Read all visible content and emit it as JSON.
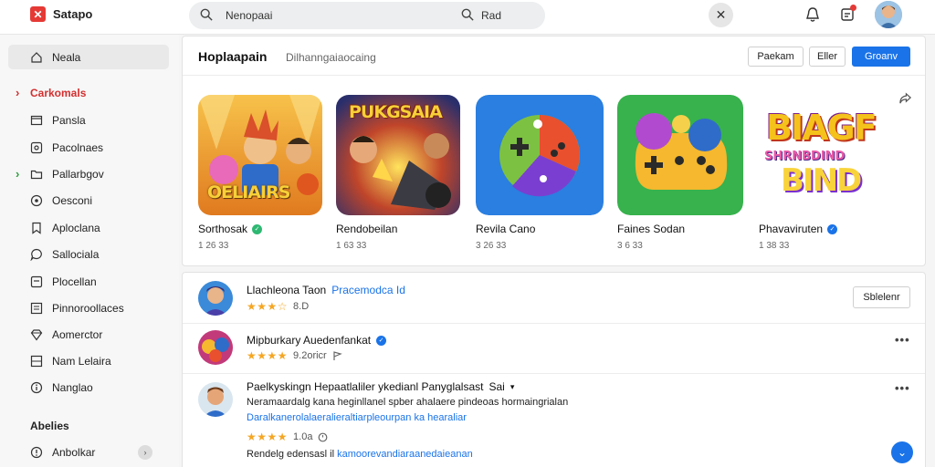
{
  "header": {
    "brand": "Satapo",
    "search_value": "Nenopaai",
    "search_secondary": "Rad",
    "close_label": "✕"
  },
  "sidebar": {
    "items": [
      {
        "label": "Neala",
        "icon": "home-icon"
      },
      {
        "label": "Carkomals",
        "icon": "chevron-right-icon"
      },
      {
        "label": "Pansla",
        "icon": "window-icon"
      },
      {
        "label": "Pacolnaes",
        "icon": "image-icon"
      },
      {
        "label": "Pallarbgov",
        "icon": "folder-icon"
      },
      {
        "label": "Oesconi",
        "icon": "compass-icon"
      },
      {
        "label": "Aploclana",
        "icon": "bookmark-icon"
      },
      {
        "label": "Sallociala",
        "icon": "chat-icon"
      },
      {
        "label": "Plocellan",
        "icon": "box-icon"
      },
      {
        "label": "Pinnoroollaces",
        "icon": "list-icon"
      },
      {
        "label": "Aomerctor",
        "icon": "diamond-icon"
      },
      {
        "label": "Nam Lelaira",
        "icon": "grid-icon"
      },
      {
        "label": "Nanglao",
        "icon": "info-icon"
      }
    ],
    "section_title": "Abelies",
    "bottom_item": {
      "label": "Anbolkar",
      "icon": "help-icon",
      "badge": "›"
    },
    "accent_red": "#d32f2f",
    "accent_green": "#2e9e3e"
  },
  "featured": {
    "title": "Hoplaapain",
    "subtitle": "Dilhanngaiaocaing",
    "buttons": {
      "first": "Paekam",
      "second": "Eller",
      "primary": "Groanv"
    },
    "apps": [
      {
        "name": "Sorthosak",
        "meta": "1 26 33",
        "verified_color": "#2eb872",
        "art": "art-1"
      },
      {
        "name": "Rendobeilan",
        "meta": "1 63 33",
        "verified_color": "",
        "art": "art-2"
      },
      {
        "name": "Revila Cano",
        "meta": "3 26 33",
        "verified_color": "",
        "art": "art-3"
      },
      {
        "name": "Faines Sodan",
        "meta": "3 6 33",
        "verified_color": "",
        "art": "art-4"
      },
      {
        "name": "Phavaviruten",
        "meta": "1 38 33",
        "verified_color": "#1a73e8",
        "art": "art-5"
      }
    ],
    "art_text": {
      "art_1": "OELIAIRS",
      "art_2": "PUKGSAIA",
      "art_5_line1": "BIAGF",
      "art_5_line2": "SHRNBDIND",
      "art_5_line3": "BIND"
    }
  },
  "list": {
    "rows": [
      {
        "title": "Llachleona Taon",
        "link": "Pracemodca Id",
        "stars": "★★★☆",
        "meta": "8.D",
        "action": "Sblelenr"
      },
      {
        "title": "Mipburkary Auedenfankat",
        "stars": "★★★★",
        "meta": "9.2oricr"
      },
      {
        "title": "Paelkyskingn Hepaatlaliler ykedianl Panyglalsast",
        "title_extra": "Sai",
        "line1": "Neramaardalg kana heginllanel spber ahalaere pindeoas hormaingrialan",
        "line2": "Daralkanerolalaeralieraltiarpleourpan ka hearaliar",
        "stars": "★★★★",
        "meta": "1.0a",
        "reply": "Rendelg edensasl il",
        "reply_link": "kamoorevandiaraanedaieanan"
      }
    ]
  }
}
